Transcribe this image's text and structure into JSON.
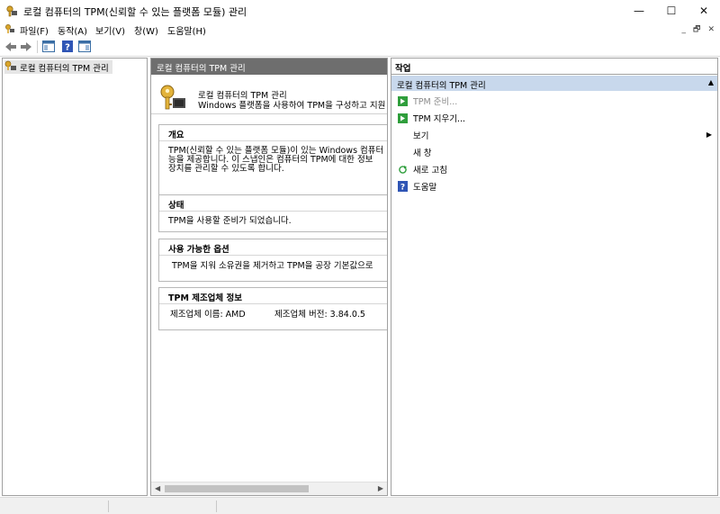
{
  "window": {
    "title": "로컬 컴퓨터의 TPM(신뢰할 수 있는 플랫폼 모듈) 관리",
    "minimize": "—",
    "maximize": "☐",
    "close": "✕"
  },
  "menubar": {
    "items": [
      "파일(F)",
      "동작(A)",
      "보기(V)",
      "창(W)",
      "도움말(H)"
    ],
    "mdi": {
      "minimize": "_",
      "restore": "🗗",
      "close": "✕"
    }
  },
  "toolbar": {
    "icons": [
      "back-arrow-icon",
      "forward-arrow-icon",
      "show-hide-tree-icon",
      "help-icon",
      "show-hide-action-pane-icon"
    ]
  },
  "tree": {
    "root_label": "로컬 컴퓨터의 TPM 관리"
  },
  "center": {
    "header": "로컬 컴퓨터의 TPM 관리",
    "intro_title": "로컬 컴퓨터의 TPM 관리",
    "intro_desc": "Windows 플랫폼을 사용하여 TPM을 구성하고 지원",
    "sections": {
      "overview": {
        "title": "개요",
        "lines": [
          "TPM(신뢰할 수 있는 플랫폼 모듈)이 있는 Windows 컴퓨터",
          "능을 제공합니다. 이 스냅인은 컴퓨터의 TPM에 대한 정보",
          "장치를 관리할 수 있도록 합니다."
        ]
      },
      "status": {
        "title": "상태",
        "text": "TPM을 사용할 준비가 되었습니다."
      },
      "options": {
        "title": "사용 가능한 옵션",
        "text": "TPM을 지워 소유권을 제거하고 TPM을 공장 기본값으로"
      },
      "manufacturer": {
        "title": "TPM 제조업체 정보",
        "name_text": "제조업체 이름: AMD",
        "version_text": "제조업체 버전: 3.84.0.5"
      }
    }
  },
  "actions": {
    "header": "작업",
    "group_title": "로컬 컴퓨터의 TPM 관리",
    "items": [
      {
        "label": "TPM 준비...",
        "icon": "green-arrow-icon",
        "enabled": false
      },
      {
        "label": "TPM 지우기...",
        "icon": "green-arrow-icon",
        "enabled": true
      },
      {
        "label": "보기",
        "icon": "",
        "enabled": true,
        "submenu": true
      },
      {
        "label": "새 창",
        "icon": "",
        "enabled": true
      },
      {
        "label": "새로 고침",
        "icon": "refresh-icon",
        "enabled": true
      },
      {
        "label": "도움말",
        "icon": "help-icon",
        "enabled": true
      }
    ]
  },
  "colors": {
    "center_header_bg": "#6e6e6e",
    "action_group_bg": "#c8d8ec",
    "disabled_text": "#8a8a8a",
    "green_arrow": "#2f9e3c",
    "help_blue": "#2f55b5"
  }
}
